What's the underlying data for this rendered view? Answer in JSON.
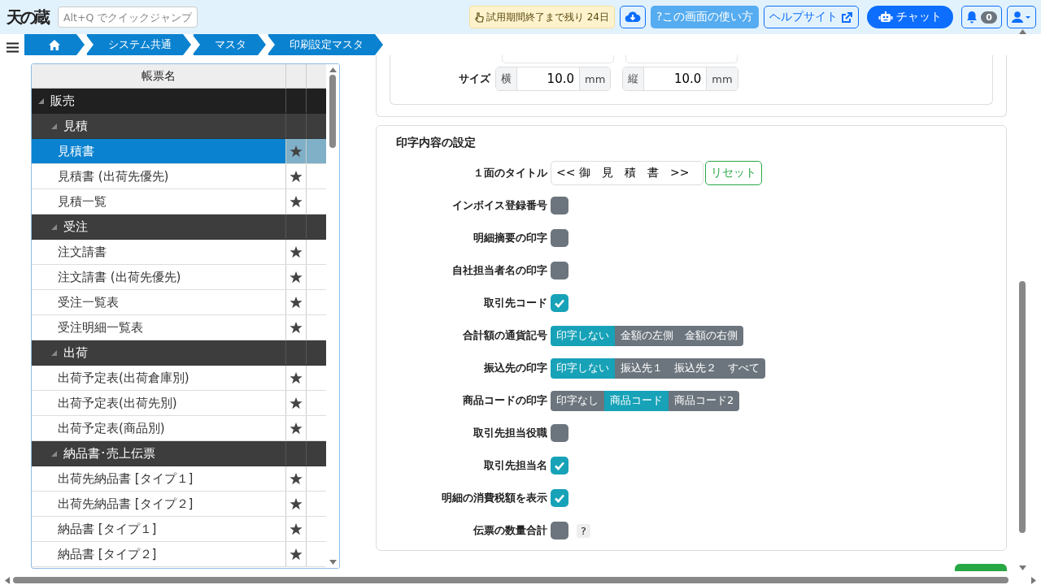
{
  "header": {
    "logo": "天の蔵",
    "search": {
      "placeholder": "Alt+Q でクイックジャンプ"
    },
    "trial_badge": "試用期間終了まで残り 24日",
    "help_button": "?この画面の使い方",
    "help_site_button": "ヘルプサイト",
    "chat_button": "チャット",
    "notification_count": "0"
  },
  "breadcrumb": [
    "システム共通",
    "マスタ",
    "印刷設定マスタ"
  ],
  "form_list": {
    "column_header": "帳票名",
    "tree": [
      {
        "label": "販売",
        "expanded": true,
        "children": [
          {
            "label": "見積",
            "expanded": true,
            "children": [
              {
                "label": "見積書",
                "selected": true
              },
              {
                "label": "見積書 (出荷先優先)",
                "selected": false
              },
              {
                "label": "見積一覧",
                "selected": false
              }
            ]
          },
          {
            "label": "受注",
            "expanded": true,
            "children": [
              {
                "label": "注文請書",
                "selected": false
              },
              {
                "label": "注文請書 (出荷先優先)",
                "selected": false
              },
              {
                "label": "受注一覧表",
                "selected": false
              },
              {
                "label": "受注明細一覧表",
                "selected": false
              }
            ]
          },
          {
            "label": "出荷",
            "expanded": true,
            "children": [
              {
                "label": "出荷予定表(出荷倉庫別)",
                "selected": false
              },
              {
                "label": "出荷予定表(出荷先別)",
                "selected": false
              },
              {
                "label": "出荷予定表(商品別)",
                "selected": false
              }
            ]
          },
          {
            "label": "納品書･売上伝票",
            "expanded": true,
            "children": [
              {
                "label": "出荷先納品書 [タイプ１]",
                "selected": false
              },
              {
                "label": "出荷先納品書 [タイプ２]",
                "selected": false
              },
              {
                "label": "納品書 [タイプ１]",
                "selected": false
              },
              {
                "label": "納品書 [タイプ２]",
                "selected": false
              }
            ]
          }
        ]
      }
    ]
  },
  "size_row": {
    "label": "サイズ",
    "fields": [
      {
        "prefix": "横",
        "value": "10.0",
        "unit": "mm"
      },
      {
        "prefix": "縦",
        "value": "10.0",
        "unit": "mm"
      }
    ]
  },
  "print_settings": {
    "title": "印字内容の設定",
    "rows": [
      {
        "kind": "text",
        "label": "１面のタイトル",
        "value": "<< 御　見　積　書　>>",
        "button": "リセット"
      },
      {
        "kind": "check",
        "label": "インボイス登録番号",
        "checked": false
      },
      {
        "kind": "check",
        "label": "明細摘要の印字",
        "checked": false
      },
      {
        "kind": "check",
        "label": "自社担当者名の印字",
        "checked": false
      },
      {
        "kind": "check",
        "label": "取引先コード",
        "checked": true
      },
      {
        "kind": "choice",
        "label": "合計額の通貨記号",
        "options": [
          {
            "label": "印字しない",
            "selected": true
          },
          {
            "label": "金額の左側",
            "selected": false
          },
          {
            "label": "金額の右側",
            "selected": false
          }
        ]
      },
      {
        "kind": "choice",
        "label": "振込先の印字",
        "options": [
          {
            "label": "印字しない",
            "selected": true
          },
          {
            "label": "振込先１",
            "selected": false
          },
          {
            "label": "振込先２",
            "selected": false
          },
          {
            "label": "すべて",
            "selected": false
          }
        ]
      },
      {
        "kind": "choice",
        "label": "商品コードの印字",
        "options": [
          {
            "label": "印字なし",
            "selected": false
          },
          {
            "label": "商品コード",
            "selected": true
          },
          {
            "label": "商品コード2",
            "selected": false
          }
        ]
      },
      {
        "kind": "check",
        "label": "取引先担当役職",
        "checked": false
      },
      {
        "kind": "check",
        "label": "取引先担当名",
        "checked": true
      },
      {
        "kind": "check",
        "label": "明細の消費税額を表示",
        "checked": true
      },
      {
        "kind": "check",
        "label": "伝票の数量合計",
        "checked": false,
        "help": "?"
      }
    ]
  }
}
